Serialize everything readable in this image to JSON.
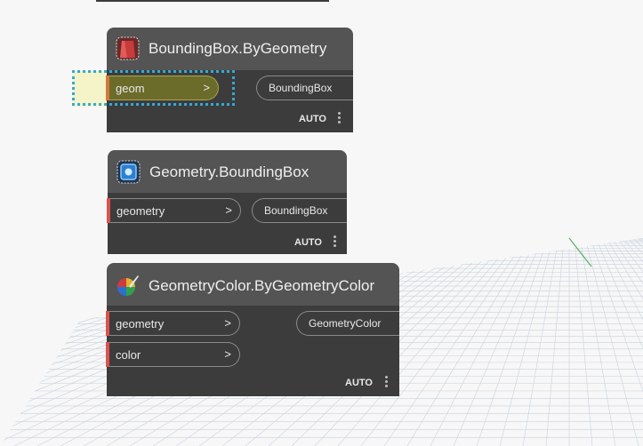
{
  "nodes": [
    {
      "title": "BoundingBox.ByGeometry",
      "icon": "bounding-box-by-geometry-icon",
      "inputs": [
        {
          "label": "geom",
          "arrow": ">"
        }
      ],
      "output": "BoundingBox",
      "lacing": "AUTO"
    },
    {
      "title": "Geometry.BoundingBox",
      "icon": "geometry-bounding-box-icon",
      "inputs": [
        {
          "label": "geometry",
          "arrow": ">"
        }
      ],
      "output": "BoundingBox",
      "lacing": "AUTO"
    },
    {
      "title": "GeometryColor.ByGeometryColor",
      "icon": "geometry-color-icon",
      "inputs": [
        {
          "label": "geometry",
          "arrow": ">"
        },
        {
          "label": "color",
          "arrow": ">"
        }
      ],
      "output": "GeometryColor",
      "lacing": "AUTO"
    }
  ],
  "colors": {
    "header": "#545454",
    "body": "#3c3c3c",
    "port_marker": "#d9534f",
    "highlight": "#32a9d6",
    "highlight_fill": "#f5f3c8",
    "canvas": "#f7f7f7"
  }
}
